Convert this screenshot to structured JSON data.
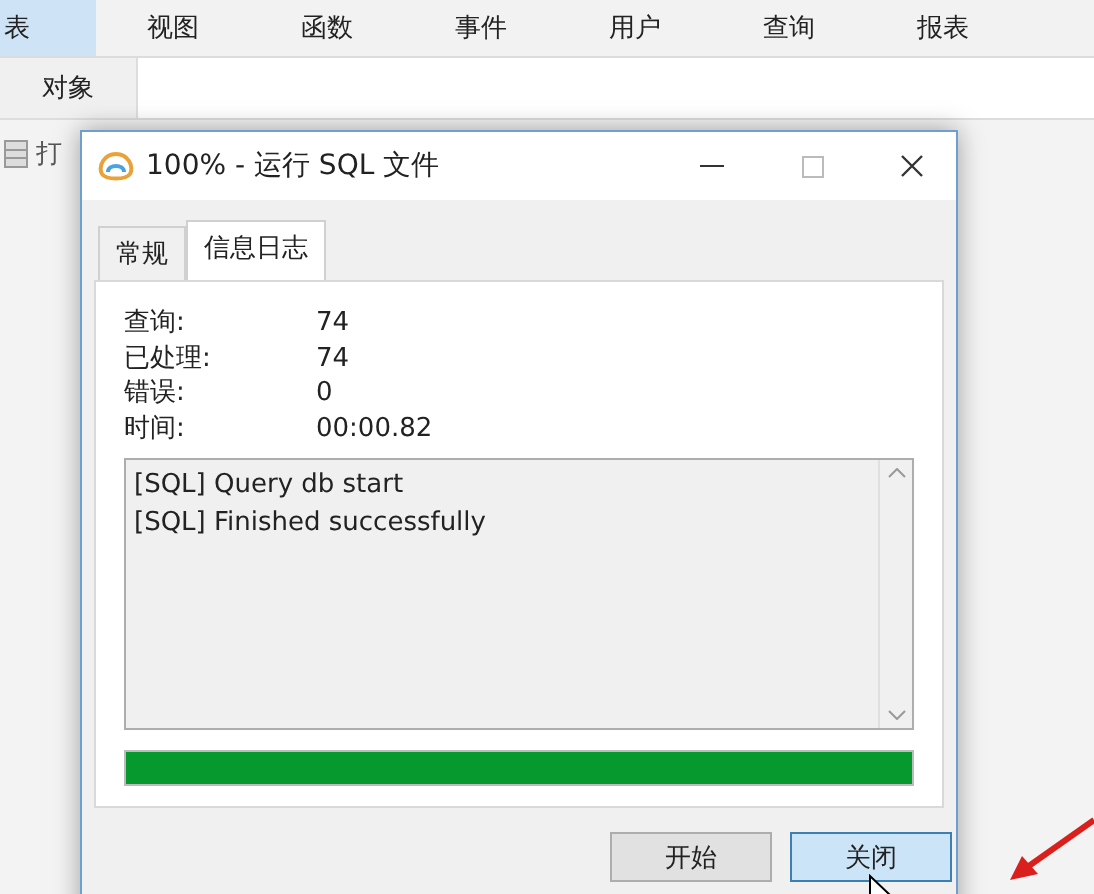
{
  "menu": [
    {
      "label": "表",
      "selected": true
    },
    {
      "label": "视图",
      "selected": false
    },
    {
      "label": "函数",
      "selected": false
    },
    {
      "label": "事件",
      "selected": false
    },
    {
      "label": "用户",
      "selected": false
    },
    {
      "label": "查询",
      "selected": false
    },
    {
      "label": "报表",
      "selected": false
    }
  ],
  "object_tab": {
    "label": "对象"
  },
  "toolbar": {
    "open_label": "打"
  },
  "dialog": {
    "title": "100% - 运行 SQL 文件",
    "tabs": [
      {
        "label": "常规",
        "selected": false
      },
      {
        "label": "信息日志",
        "selected": true
      }
    ],
    "stats": [
      {
        "label": "查询:",
        "value": "74"
      },
      {
        "label": "已处理:",
        "value": "74"
      },
      {
        "label": "错误:",
        "value": "0"
      },
      {
        "label": "时间:",
        "value": "00:00.82"
      }
    ],
    "log": [
      "[SQL] Query db start",
      "[SQL] Finished successfully"
    ],
    "progress": {
      "level": 1.0
    },
    "buttons": [
      {
        "label": "开始",
        "selected": false
      },
      {
        "label": "关闭",
        "selected": true
      }
    ]
  }
}
